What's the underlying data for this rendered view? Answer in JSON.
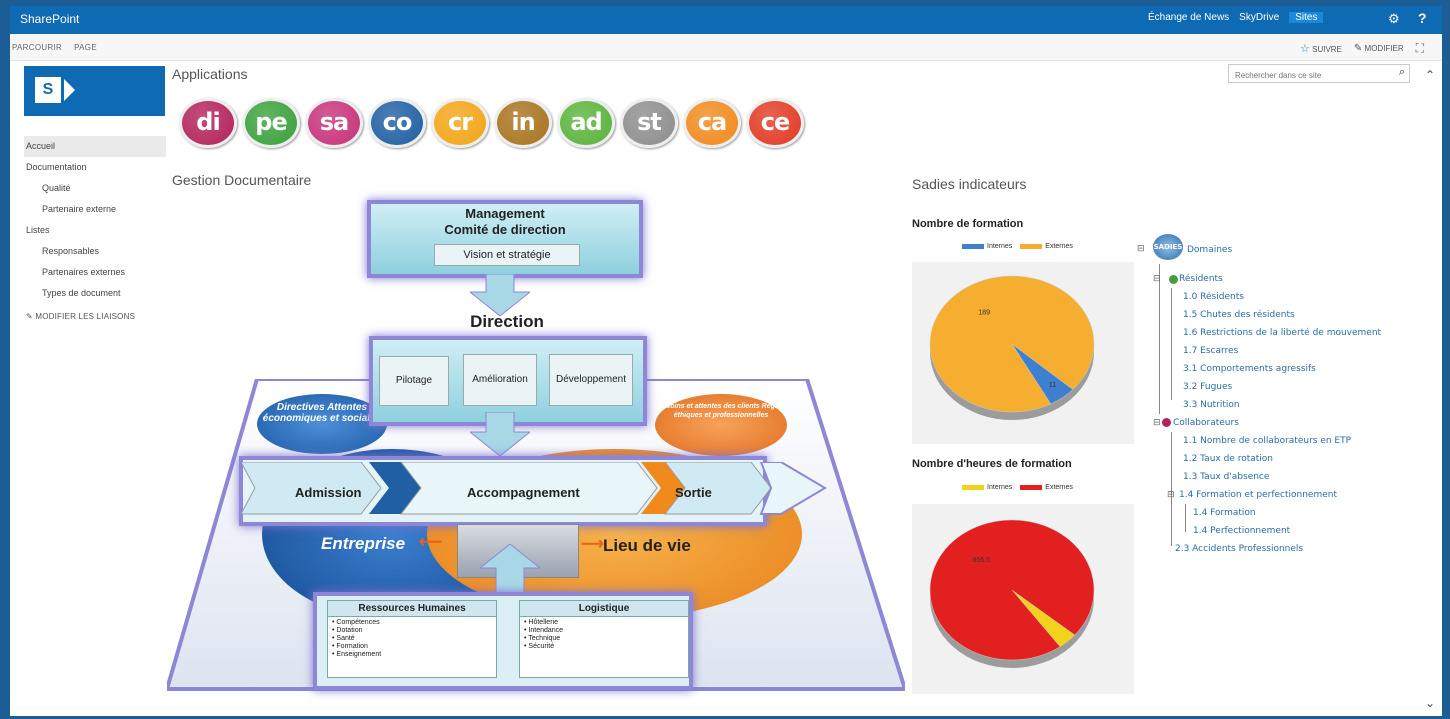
{
  "suite_bar": {
    "brand": "SharePoint",
    "links": [
      "Échange de News",
      "SkyDrive",
      "Sites"
    ],
    "active_link": "Sites",
    "gear_icon": "gear-icon",
    "help_label": "?"
  },
  "ribbon": {
    "tabs": [
      "PARCOURIR",
      "PAGE"
    ],
    "follow_label": "SUIVRE",
    "edit_label": "MODIFIER"
  },
  "logo": {
    "letter": "S"
  },
  "left_nav": {
    "items": [
      {
        "label": "Accueil",
        "level": "top",
        "selected": true
      },
      {
        "label": "Documentation",
        "level": "top"
      },
      {
        "label": "Qualité",
        "level": "sub"
      },
      {
        "label": "Partenaire externe",
        "level": "sub"
      },
      {
        "label": "Listes",
        "level": "top"
      },
      {
        "label": "Responsables",
        "level": "sub"
      },
      {
        "label": "Partenaires externes",
        "level": "sub"
      },
      {
        "label": "Types de document",
        "level": "sub"
      }
    ],
    "edit_links_label": "MODIFIER LES LIAISONS"
  },
  "search": {
    "placeholder": "Rechercher dans ce site"
  },
  "applications": {
    "title": "Applications",
    "apps": [
      {
        "label": "di",
        "color": "#b3225a"
      },
      {
        "label": "pe",
        "color": "#3aa13b"
      },
      {
        "label": "sa",
        "color": "#c7327a"
      },
      {
        "label": "co",
        "color": "#1f5fa3"
      },
      {
        "label": "cr",
        "color": "#f2a515"
      },
      {
        "label": "in",
        "color": "#a8731e"
      },
      {
        "label": "ad",
        "color": "#5ab33a"
      },
      {
        "label": "st",
        "color": "#8d8d8d"
      },
      {
        "label": "ca",
        "color": "#f08a1c"
      },
      {
        "label": "ce",
        "color": "#e13a24"
      }
    ]
  },
  "documents": {
    "title": "Gestion Documentaire",
    "management_line1": "Management",
    "management_line2": "Comité de direction",
    "vision_label": "Vision et stratégie",
    "direction_label": "Direction",
    "direction_buttons": [
      "Pilotage",
      "Amélioration",
      "Développement"
    ],
    "left_bubble": "Directives Attentes économiques et sociales",
    "right_bubble": "Besoins et attentes des clients Règles éthiques et professionnelles",
    "flow": [
      "Admission",
      "Accompagnement",
      "Sortie"
    ],
    "entreprise_label": "Entreprise",
    "lieu_label": "Lieu de vie",
    "rh_title": "Ressources Humaines",
    "rh_items": [
      "Compétences",
      "Dotation",
      "Santé",
      "Formation",
      "Enseignement"
    ],
    "log_title": "Logistique",
    "log_items": [
      "Hôtellerie",
      "Intendance",
      "Technique",
      "Sécurité"
    ]
  },
  "indicators": {
    "title": "Sadies indicateurs",
    "tree": {
      "root_badge": "SADIES",
      "root_label": "Domaines",
      "residents_label": "Résidents",
      "residents_items": [
        "1.0 Résidents",
        "1.5 Chutes des résidents",
        "1.6 Restrictions de la liberté de mouvement",
        "1.7 Escarres",
        "3.1 Comportements agressifs",
        "3.2 Fugues",
        "3.3 Nutrition"
      ],
      "collab_label": "Collaborateurs",
      "collab_items": [
        "1.1 Nombre de collaborateurs en ETP",
        "1.2 Taux de rotation",
        "1.3 Taux d'absence"
      ],
      "formation_label": "1.4 Formation et perfectionnement",
      "formation_items": [
        "1.4 Formation",
        "1.4 Perfectionnement"
      ],
      "last_item": "2.3 Accidents Professionnels"
    }
  },
  "chart_data": [
    {
      "type": "pie",
      "title": "Nombre de formation",
      "legend_position": "top",
      "categories": [
        "Internes",
        "Externes"
      ],
      "values": [
        11,
        189
      ],
      "colors": [
        "#3f7fd0",
        "#f5ae30"
      ]
    },
    {
      "type": "pie",
      "title": "Nombre d'heures de formation",
      "legend_position": "top",
      "categories": [
        "Internes",
        "Externes"
      ],
      "values": [
        35,
        856.5
      ],
      "value_labels": [
        "",
        "856.5"
      ],
      "colors": [
        "#f2d21a",
        "#e32020"
      ]
    }
  ]
}
